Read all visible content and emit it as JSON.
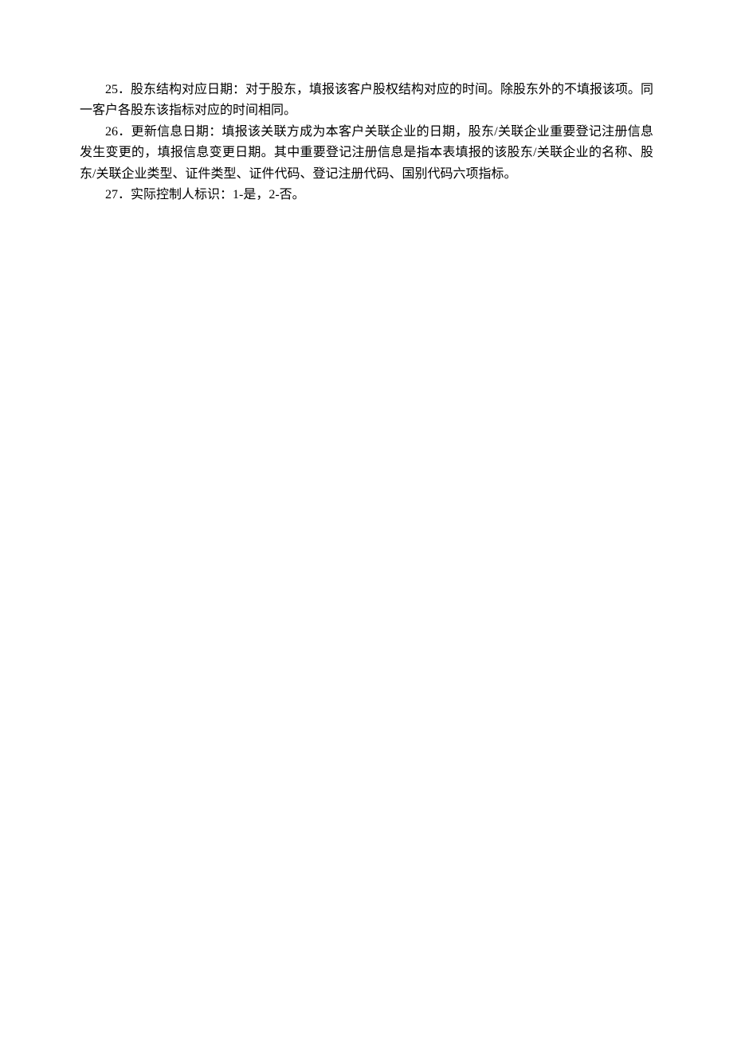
{
  "paragraphs": {
    "p25": "25．股东结构对应日期：对于股东，填报该客户股权结构对应的时间。除股东外的不填报该项。同一客户各股东该指标对应的时间相同。",
    "p26": "26．更新信息日期：填报该关联方成为本客户关联企业的日期，股东/关联企业重要登记注册信息发生变更的，填报信息变更日期。其中重要登记注册信息是指本表填报的该股东/关联企业的名称、股东/关联企业类型、证件类型、证件代码、登记注册代码、国别代码六项指标。",
    "p27": "27．实际控制人标识：1-是，2-否。"
  }
}
